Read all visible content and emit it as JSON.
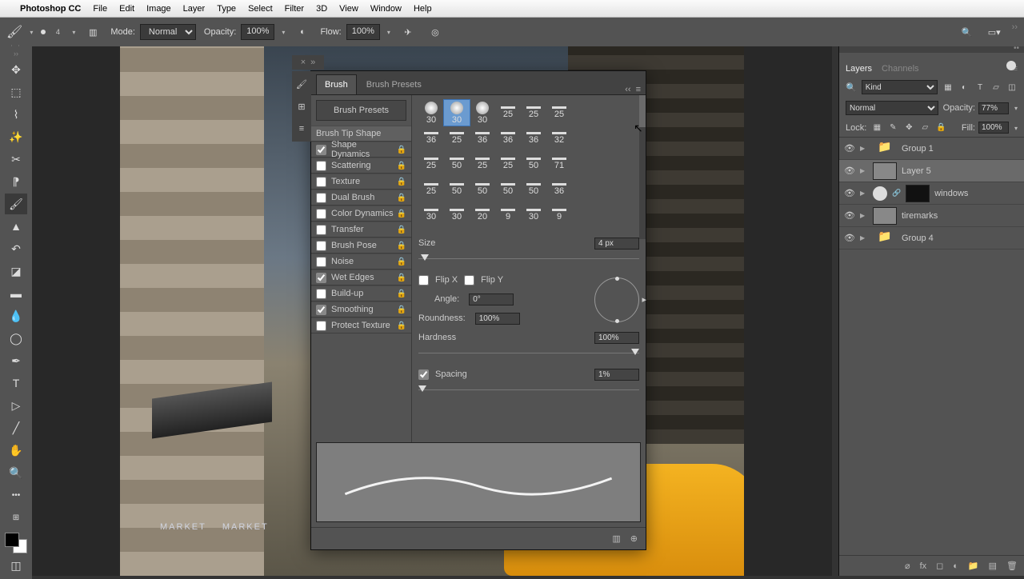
{
  "menubar": {
    "app": "Photoshop CC",
    "items": [
      "File",
      "Edit",
      "Image",
      "Layer",
      "Type",
      "Select",
      "Filter",
      "3D",
      "View",
      "Window",
      "Help"
    ]
  },
  "options": {
    "brush_size": "4",
    "mode_label": "Mode:",
    "mode_value": "Normal",
    "opacity_label": "Opacity:",
    "opacity_value": "100%",
    "flow_label": "Flow:",
    "flow_value": "100%"
  },
  "brushpanel": {
    "tabs": {
      "brush": "Brush",
      "presets": "Brush Presets"
    },
    "presetbtn": "Brush Presets",
    "options": [
      {
        "label": "Brush Tip Shape",
        "checked": null,
        "header": true
      },
      {
        "label": "Shape Dynamics",
        "checked": true
      },
      {
        "label": "Scattering",
        "checked": false
      },
      {
        "label": "Texture",
        "checked": false
      },
      {
        "label": "Dual Brush",
        "checked": false
      },
      {
        "label": "Color Dynamics",
        "checked": false
      },
      {
        "label": "Transfer",
        "checked": false
      },
      {
        "label": "Brush Pose",
        "checked": false
      },
      {
        "label": "Noise",
        "checked": false
      },
      {
        "label": "Wet Edges",
        "checked": true
      },
      {
        "label": "Build-up",
        "checked": false
      },
      {
        "label": "Smoothing",
        "checked": true
      },
      {
        "label": "Protect Texture",
        "checked": false
      }
    ],
    "tips": [
      "30",
      "30",
      "30",
      "25",
      "25",
      "25",
      "36",
      "25",
      "36",
      "36",
      "36",
      "32",
      "25",
      "50",
      "25",
      "25",
      "50",
      "71",
      "25",
      "50",
      "50",
      "50",
      "50",
      "36",
      "30",
      "30",
      "20",
      "9",
      "30",
      "9"
    ],
    "size_label": "Size",
    "size_value": "4 px",
    "flipx": "Flip X",
    "flipy": "Flip Y",
    "angle_label": "Angle:",
    "angle_value": "0°",
    "roundness_label": "Roundness:",
    "roundness_value": "100%",
    "hardness_label": "Hardness",
    "hardness_value": "100%",
    "spacing_label": "Spacing",
    "spacing_value": "1%"
  },
  "layerspanel": {
    "tabs": {
      "layers": "Layers",
      "channels": "Channels"
    },
    "kind": "Kind",
    "blend": "Normal",
    "opacity_label": "Opacity:",
    "opacity_value": "77%",
    "lock_label": "Lock:",
    "fill_label": "Fill:",
    "fill_value": "100%",
    "layers": [
      {
        "name": "Group 1",
        "type": "folder"
      },
      {
        "name": "Layer 5",
        "type": "pixel",
        "selected": true
      },
      {
        "name": "windows",
        "type": "adjust"
      },
      {
        "name": "tiremarks",
        "type": "pixel"
      },
      {
        "name": "Group 4",
        "type": "folder"
      }
    ]
  },
  "canvas": {
    "sign": "MARKET"
  }
}
